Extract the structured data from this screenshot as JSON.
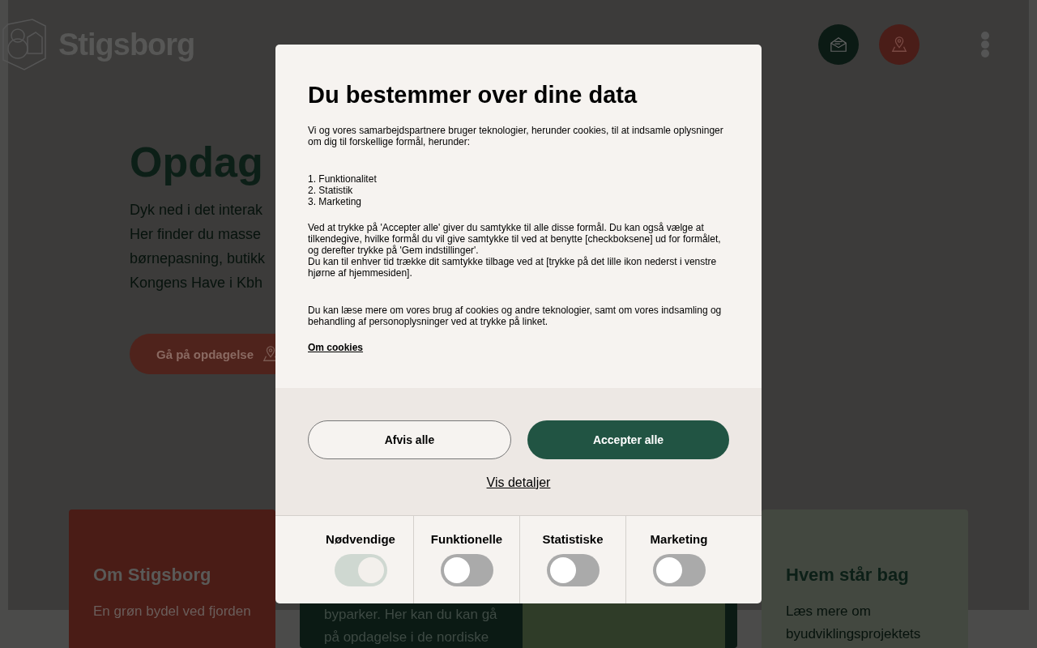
{
  "header": {
    "logo_text": "Stigsborg"
  },
  "hero": {
    "title": "Opdag",
    "lines": [
      "Dyk ned i det interak",
      "Her finder du masse",
      "børnepasning, butikk",
      "Kongens Have i Kbh"
    ],
    "button": "Gå på opdagelse"
  },
  "cards": [
    {
      "kind": "text",
      "title": "Om Stigsborg",
      "text": "En grøn bydel ved fjorden"
    },
    {
      "kind": "photo",
      "text": "byparker. Her kan du kan gå på opdagelse i de nordiske"
    },
    {
      "kind": "text",
      "title": "Hvem står bag",
      "text": "Læs mere om byudviklingsprojektets"
    }
  ],
  "consent": {
    "title": "Du bestemmer over dine data",
    "intro": "Vi og vores samarbejdspartnere bruger teknologier, herunder cookies, til at indsamle oplysninger om dig til forskellige formål, herunder:",
    "purposes": [
      "1. Funktionalitet",
      "2. Statistik",
      "3. Marketing"
    ],
    "paragraphs": [
      "Ved at trykke på 'Accepter alle' giver du samtykke til alle disse formål. Du kan også vælge at tilkendegive, hvilke formål du vil give samtykke til ved at benytte [checkboksene] ud for formålet, og derefter trykke på 'Gem indstillinger'.",
      "Du kan til enhver tid trække dit samtykke tilbage ved at [trykke på det lille ikon nederst i venstre hjørne af hjemmesiden]."
    ],
    "more": "Du kan læse mere om vores brug af cookies og andre teknologier, samt om vores indsamling og behandling af personoplysninger ved at trykke på linket.",
    "link": "Om cookies",
    "reject": "Afvis alle",
    "accept": "Accepter alle",
    "details": "Vis detaljer",
    "toggles": [
      {
        "label": "Nødvendige",
        "on": true,
        "disabled": true
      },
      {
        "label": "Funktionelle",
        "on": false,
        "disabled": false
      },
      {
        "label": "Statistiske",
        "on": false,
        "disabled": false
      },
      {
        "label": "Marketing",
        "on": false,
        "disabled": false
      }
    ]
  }
}
